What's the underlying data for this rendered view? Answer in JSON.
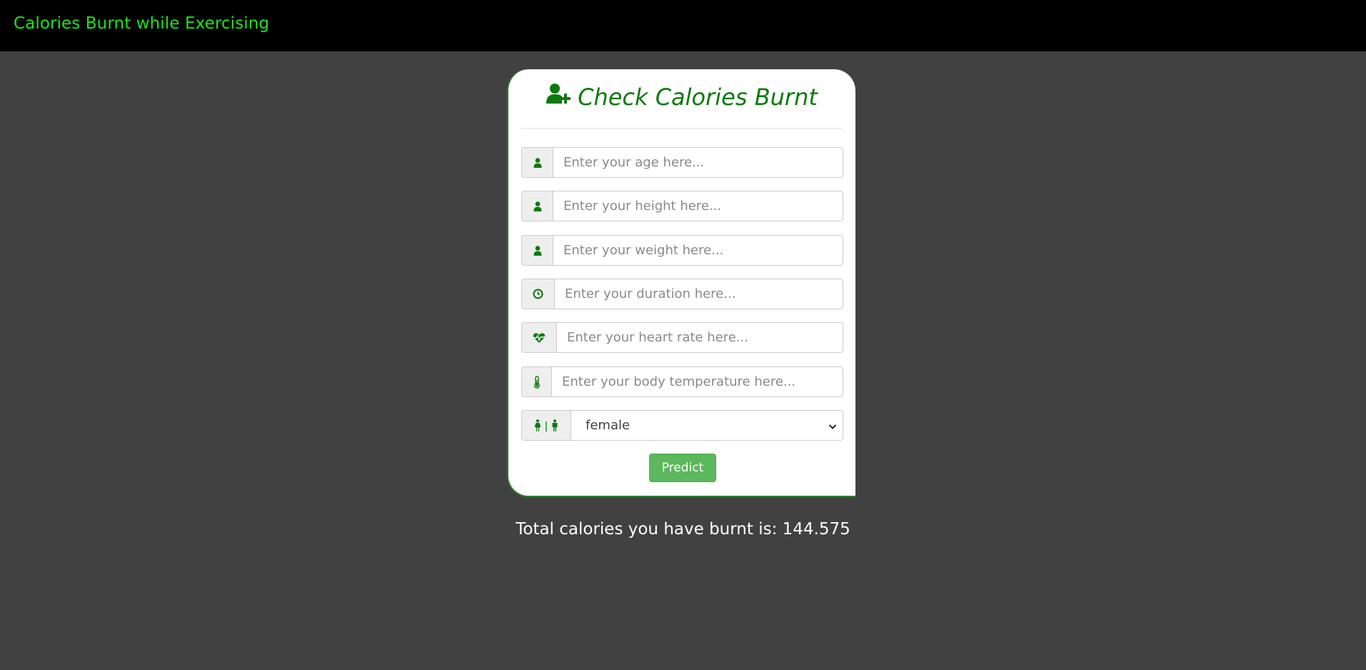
{
  "navbar": {
    "brand": "Calories Burnt while Exercising"
  },
  "card": {
    "title": "Check Calories Burnt",
    "title_icon": "user-plus-icon",
    "fields": [
      {
        "icon": "user-icon",
        "placeholder": "Enter your age here...",
        "value": ""
      },
      {
        "icon": "user-icon",
        "placeholder": "Enter your height here...",
        "value": ""
      },
      {
        "icon": "user-icon",
        "placeholder": "Enter your weight here...",
        "value": ""
      },
      {
        "icon": "clock-icon",
        "placeholder": "Enter your duration here...",
        "value": ""
      },
      {
        "icon": "heartbeat-icon",
        "placeholder": "Enter your heart rate here...",
        "value": ""
      },
      {
        "icon": "thermometer-icon",
        "placeholder": "Enter your body temperature here...",
        "value": ""
      }
    ],
    "gender": {
      "icon": "gender-icon",
      "separator": "|",
      "selected": "female"
    },
    "predict_label": "Predict"
  },
  "result": {
    "text": "Total calories you have burnt is: 144.575"
  },
  "colors": {
    "brand": "#19e619",
    "accent": "#0a7a0a",
    "button": "#5cb85c",
    "background": "#414141"
  }
}
